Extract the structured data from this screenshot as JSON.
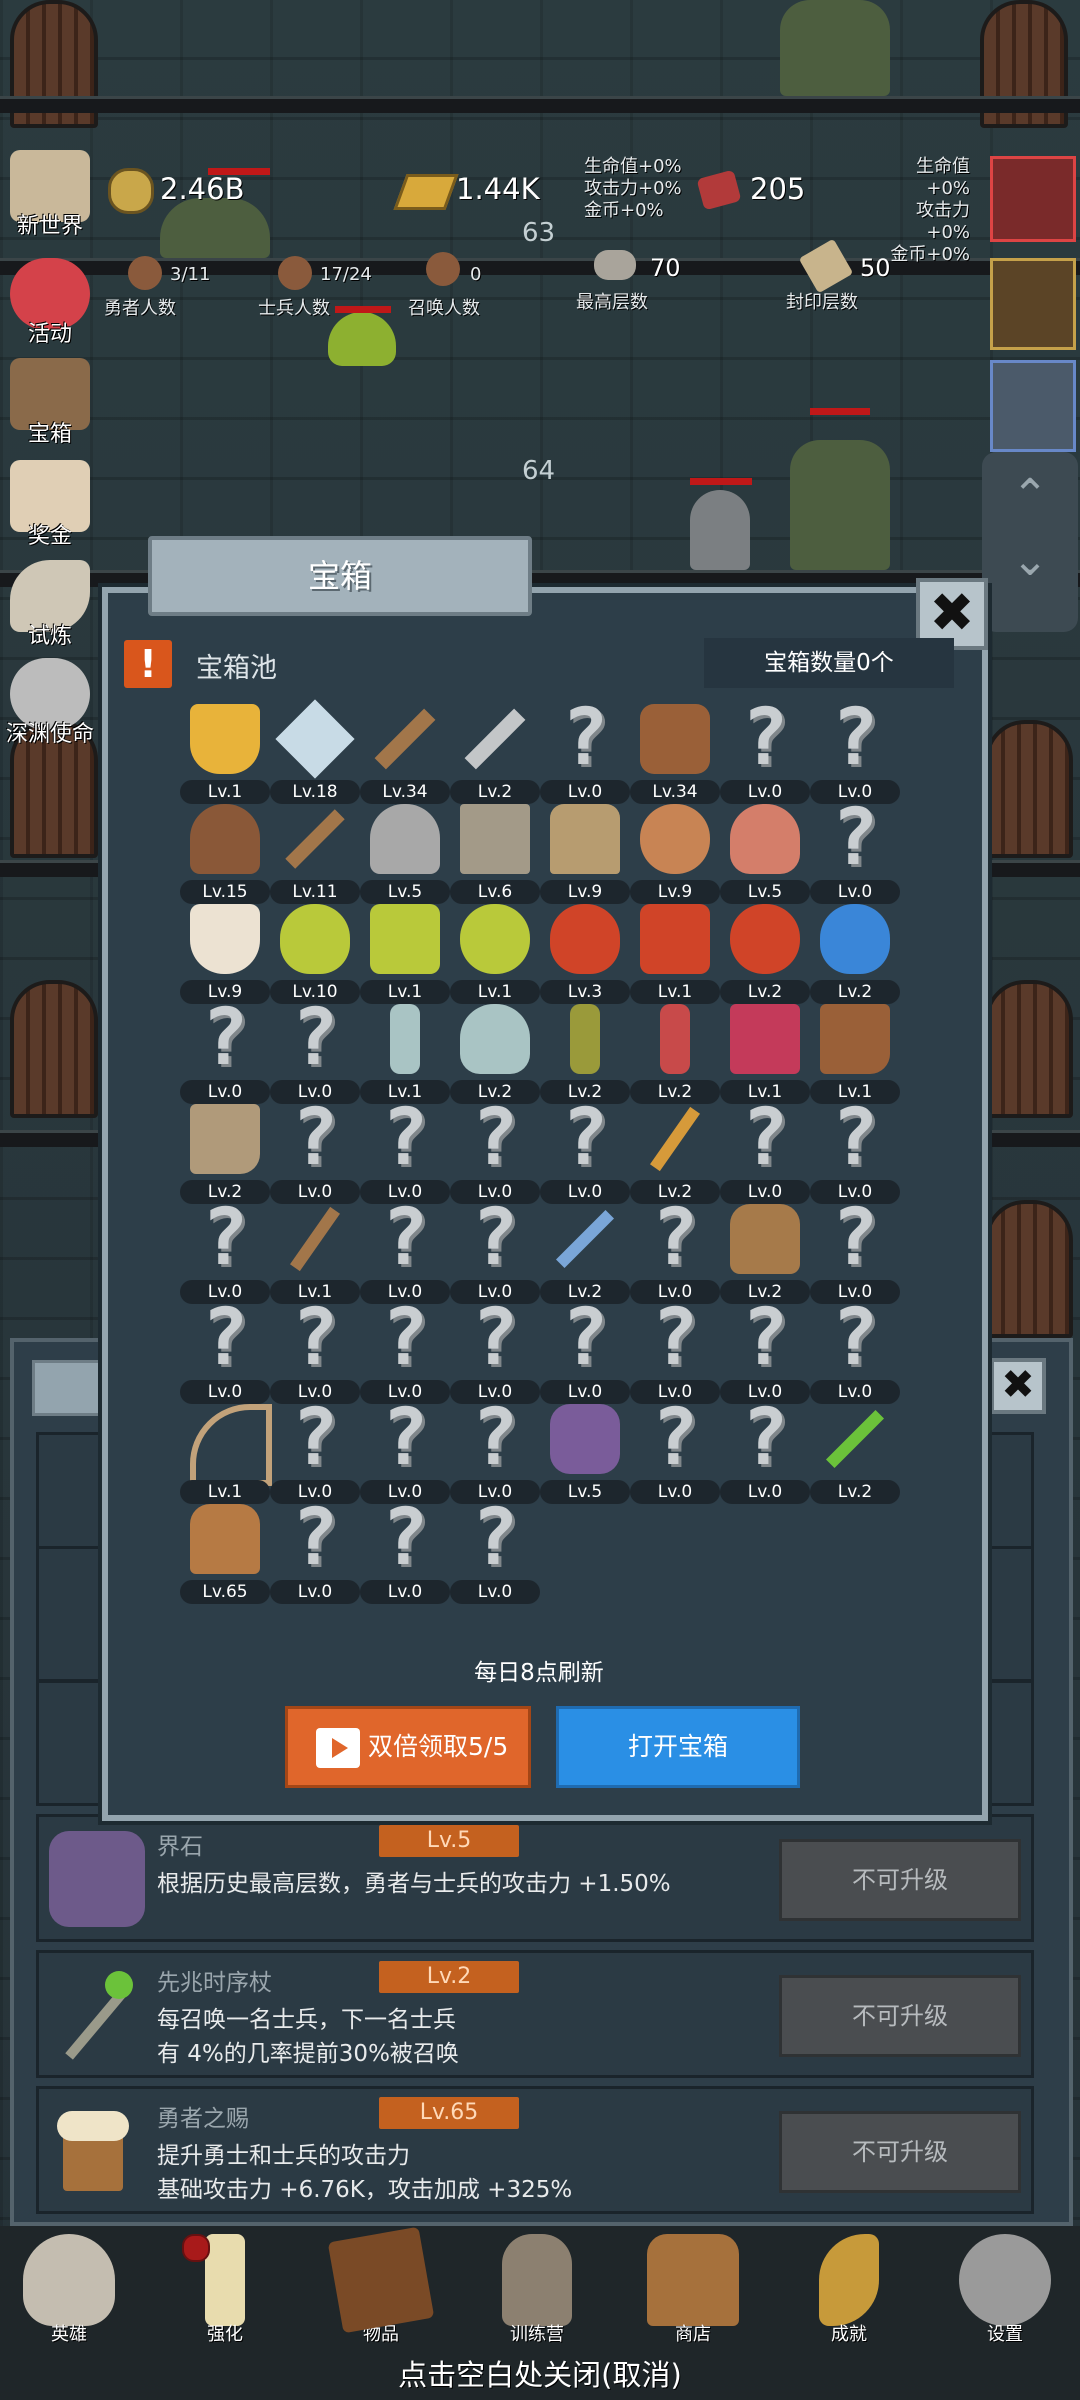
{
  "top_counter": "63",
  "hud": {
    "gold": "2.46B",
    "gold_bar": "1.44K",
    "meat": "205",
    "bonus_left": [
      "生命值+0%",
      "攻击力+0%",
      "金币+0%"
    ],
    "bonus_right": [
      "生命值+0%",
      "攻击力+0%",
      "金币+0%"
    ],
    "stats": [
      {
        "value": "3/11",
        "label": "勇者人数"
      },
      {
        "value": "17/24",
        "label": "士兵人数"
      },
      {
        "value": "0",
        "label": "召唤人数"
      },
      {
        "value": "70",
        "label": "最高层数"
      },
      {
        "value": "50",
        "label": "封印层数"
      }
    ]
  },
  "floors": {
    "a": "63",
    "b": "64"
  },
  "side_menu": [
    "新世界",
    "活动",
    "宝箱",
    "奖金",
    "试炼",
    "深渊使命"
  ],
  "modal": {
    "title": "宝箱",
    "pool_title": "宝箱池",
    "chest_count": "宝箱数量0个",
    "refresh_text": "每日8点刷新",
    "double_button": "双倍领取5/5",
    "open_button": "打开宝箱",
    "items": [
      {
        "icon": "crown-icon",
        "lv": "Lv.1"
      },
      {
        "icon": "diamond-icon",
        "lv": "Lv.18"
      },
      {
        "icon": "wooden-sword-icon",
        "lv": "Lv.34"
      },
      {
        "icon": "iron-sword-icon",
        "lv": "Lv.2"
      },
      {
        "icon": "unknown-icon",
        "lv": "Lv.0"
      },
      {
        "icon": "leather-armor-icon",
        "lv": "Lv.34"
      },
      {
        "icon": "unknown-icon",
        "lv": "Lv.0"
      },
      {
        "icon": "unknown-icon",
        "lv": "Lv.0"
      },
      {
        "icon": "leather-helmet-icon",
        "lv": "Lv.15"
      },
      {
        "icon": "dagger-icon",
        "lv": "Lv.11"
      },
      {
        "icon": "knight-helmet-icon",
        "lv": "Lv.5"
      },
      {
        "icon": "hammer-icon",
        "lv": "Lv.6"
      },
      {
        "icon": "great-helm-icon",
        "lv": "Lv.9"
      },
      {
        "icon": "ham-icon",
        "lv": "Lv.9"
      },
      {
        "icon": "steak-icon",
        "lv": "Lv.5"
      },
      {
        "icon": "unknown-icon",
        "lv": "Lv.0"
      },
      {
        "icon": "flour-bowl-icon",
        "lv": "Lv.9"
      },
      {
        "icon": "yellow-potion-icon",
        "lv": "Lv.10"
      },
      {
        "icon": "yellow-potion-square-icon",
        "lv": "Lv.1"
      },
      {
        "icon": "yellow-potion-round-icon",
        "lv": "Lv.1"
      },
      {
        "icon": "red-potion-icon",
        "lv": "Lv.3"
      },
      {
        "icon": "red-potion-square-icon",
        "lv": "Lv.1"
      },
      {
        "icon": "red-potion-round-icon",
        "lv": "Lv.2"
      },
      {
        "icon": "blue-potion-icon",
        "lv": "Lv.2"
      },
      {
        "icon": "unknown-icon",
        "lv": "Lv.0"
      },
      {
        "icon": "unknown-icon",
        "lv": "Lv.0"
      },
      {
        "icon": "empty-bottle-icon",
        "lv": "Lv.1"
      },
      {
        "icon": "empty-flask-icon",
        "lv": "Lv.2"
      },
      {
        "icon": "olive-bottle-icon",
        "lv": "Lv.2"
      },
      {
        "icon": "red-bottle-icon",
        "lv": "Lv.2"
      },
      {
        "icon": "winged-boot-icon",
        "lv": "Lv.1"
      },
      {
        "icon": "leather-boot-icon",
        "lv": "Lv.1"
      },
      {
        "icon": "cloth-shoe-icon",
        "lv": "Lv.2"
      },
      {
        "icon": "unknown-icon",
        "lv": "Lv.0"
      },
      {
        "icon": "unknown-icon",
        "lv": "Lv.0"
      },
      {
        "icon": "unknown-icon",
        "lv": "Lv.0"
      },
      {
        "icon": "unknown-icon",
        "lv": "Lv.0"
      },
      {
        "icon": "torch-wand-icon",
        "lv": "Lv.2"
      },
      {
        "icon": "unknown-icon",
        "lv": "Lv.0"
      },
      {
        "icon": "unknown-icon",
        "lv": "Lv.0"
      },
      {
        "icon": "unknown-icon",
        "lv": "Lv.0"
      },
      {
        "icon": "wooden-staff-icon",
        "lv": "Lv.1"
      },
      {
        "icon": "unknown-icon",
        "lv": "Lv.0"
      },
      {
        "icon": "unknown-icon",
        "lv": "Lv.0"
      },
      {
        "icon": "blue-orb-staff-icon",
        "lv": "Lv.2"
      },
      {
        "icon": "unknown-icon",
        "lv": "Lv.0"
      },
      {
        "icon": "backpack-icon",
        "lv": "Lv.2"
      },
      {
        "icon": "unknown-icon",
        "lv": "Lv.0"
      },
      {
        "icon": "unknown-icon",
        "lv": "Lv.0"
      },
      {
        "icon": "unknown-icon",
        "lv": "Lv.0"
      },
      {
        "icon": "unknown-icon",
        "lv": "Lv.0"
      },
      {
        "icon": "unknown-icon",
        "lv": "Lv.0"
      },
      {
        "icon": "unknown-icon",
        "lv": "Lv.0"
      },
      {
        "icon": "unknown-icon",
        "lv": "Lv.0"
      },
      {
        "icon": "unknown-icon",
        "lv": "Lv.0"
      },
      {
        "icon": "unknown-icon",
        "lv": "Lv.0"
      },
      {
        "icon": "bow-icon",
        "lv": "Lv.1"
      },
      {
        "icon": "unknown-icon",
        "lv": "Lv.0"
      },
      {
        "icon": "unknown-icon",
        "lv": "Lv.0"
      },
      {
        "icon": "unknown-icon",
        "lv": "Lv.0"
      },
      {
        "icon": "boundary-stone-icon",
        "lv": "Lv.5"
      },
      {
        "icon": "unknown-icon",
        "lv": "Lv.0"
      },
      {
        "icon": "unknown-icon",
        "lv": "Lv.0"
      },
      {
        "icon": "green-orb-staff-icon",
        "lv": "Lv.2"
      },
      {
        "icon": "ale-mug-icon",
        "lv": "Lv.65"
      },
      {
        "icon": "unknown-icon",
        "lv": "Lv.0"
      },
      {
        "icon": "unknown-icon",
        "lv": "Lv.0"
      },
      {
        "icon": "unknown-icon",
        "lv": "Lv.0"
      }
    ]
  },
  "list_rows": [
    {
      "icon": "boundary-stone-icon",
      "title": "界石",
      "lv": "Lv.5",
      "desc": "根据历史最高层数，勇者与士兵的攻击力 +1.50%",
      "button": "不可升级"
    },
    {
      "icon": "green-orb-staff-icon",
      "title": "先兆时序杖",
      "lv": "Lv.2",
      "desc": "每召唤一名士兵，下一名士兵\n有 4%的几率提前30%被召唤",
      "button": "不可升级"
    },
    {
      "icon": "ale-mug-icon",
      "title": "勇者之赐",
      "lv": "Lv.65",
      "desc": "提升勇士和士兵的攻击力\n基础攻击力 +6.76K，攻击加成 +325%",
      "button": "不可升级"
    }
  ],
  "bottom_nav": [
    "英雄",
    "强化",
    "物品",
    "训练营",
    "商店",
    "成就",
    "设置"
  ],
  "close_hint": "点击空白处关闭(取消)"
}
